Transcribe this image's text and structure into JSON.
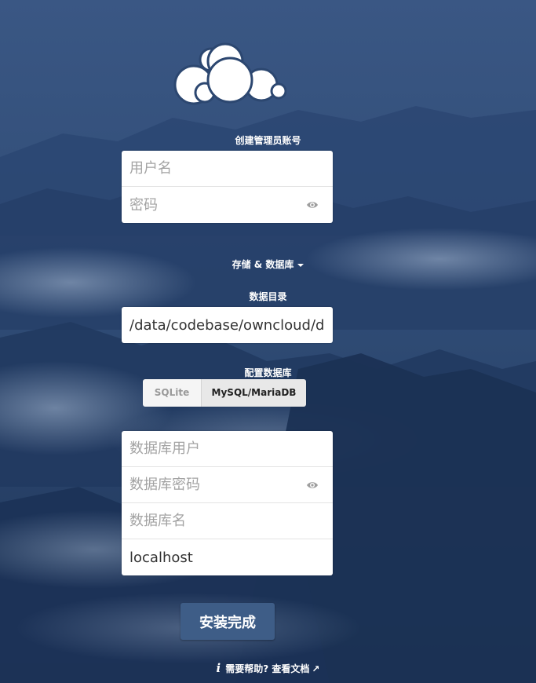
{
  "admin_section": {
    "title": "创建管理员账号",
    "username_placeholder": "用户名",
    "password_placeholder": "密码"
  },
  "storage_section": {
    "toggle_label": "存储 & 数据库",
    "data_dir_label": "数据目录",
    "data_dir_value": "/data/codebase/owncloud/data"
  },
  "database_section": {
    "label": "配置数据库",
    "options": [
      "SQLite",
      "MySQL/MariaDB"
    ],
    "selected": "MySQL/MariaDB",
    "db_user_placeholder": "数据库用户",
    "db_password_placeholder": "数据库密码",
    "db_name_placeholder": "数据库名",
    "db_host_value": "localhost"
  },
  "submit_label": "安装完成",
  "help": {
    "info_glyph": "i",
    "text": "需要帮助?",
    "link_text": "查看文档",
    "link_arrow": "↗"
  },
  "colors": {
    "background": "#2c4770",
    "button": "#3e5d87",
    "text": "#ffffff"
  }
}
